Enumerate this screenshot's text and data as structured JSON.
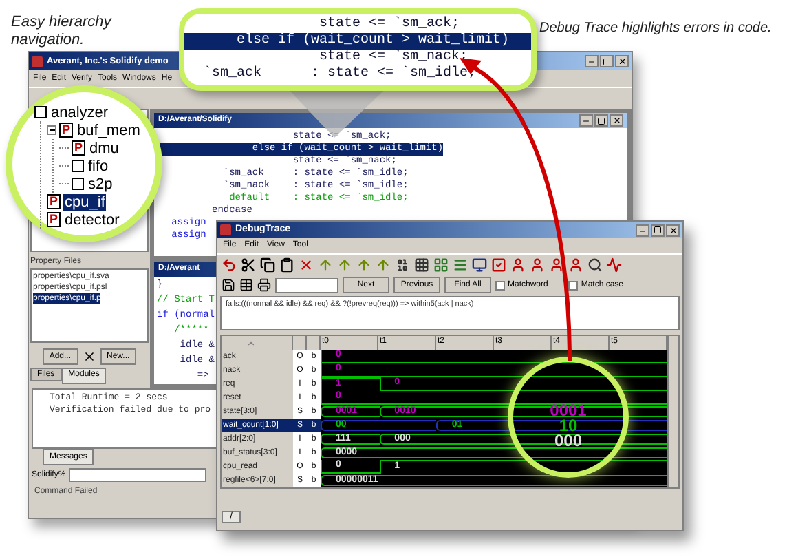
{
  "captions": [
    {
      "text": "Easy hierarchy navigation."
    },
    {
      "text": "Debug Trace highlights errors in code."
    }
  ],
  "main_window": {
    "title": "Averant, Inc.'s Solidify demo",
    "menu": [
      "File",
      "Edit",
      "Verify",
      "Tools",
      "Windows",
      "He"
    ],
    "code_window": {
      "title": "D:/Averant/Solidify",
      "lines": [
        {
          "text": "                        state <= `sm_ack;",
          "kind": "statement",
          "selected": false
        },
        {
          "text": "                 else if (wait_count > wait_limit)",
          "selected": true
        },
        {
          "text": "                        state <= `sm_nack;",
          "kind": "statement",
          "selected": false
        },
        {
          "text": "            `sm_ack     : state <= `sm_idle;",
          "kind": "statement",
          "selected": false
        },
        {
          "text": "            `sm_nack    : state <= `sm_idle;",
          "kind": "statement",
          "selected": false
        },
        {
          "text": "             default    : state <= `sm_idle;",
          "kind": "comment",
          "selected": false
        },
        {
          "text": "          endcase",
          "kind": "statement",
          "selected": false
        },
        {
          "text": "   assign",
          "kind": "keyword",
          "selected": false
        },
        {
          "text": "   assign",
          "kind": "keyword",
          "selected": false
        }
      ]
    },
    "lower_window": {
      "title": "D:/Averant",
      "lines": [
        {
          "text": "}",
          "kind": "statement"
        },
        {
          "text": "// Start T",
          "kind": "comment"
        },
        {
          "text": "if (normal",
          "kind": "keyword"
        },
        {
          "text": "   /*****",
          "kind": "comment"
        },
        {
          "text": "    idle &",
          "kind": "statement"
        },
        {
          "text": "    idle &",
          "kind": "statement"
        },
        {
          "text": "       =>",
          "kind": "statement"
        }
      ]
    },
    "property_files": {
      "label": "Property Files",
      "items": [
        {
          "text": "properties\\cpu_if.sva",
          "selected": false
        },
        {
          "text": "properties\\cpu_if.psl",
          "selected": false
        },
        {
          "text": "properties\\cpu_if.p",
          "selected": true
        }
      ]
    },
    "buttons": [
      "Add...",
      "New..."
    ],
    "tabs": [
      {
        "label": "Files",
        "selected": false
      },
      {
        "label": "Modules",
        "selected": true
      }
    ],
    "messages": {
      "lines": [
        "Total Runtime = 2 secs",
        "Verification failed due to pro"
      ],
      "tab": "Messages"
    },
    "prompt": "Solidify%",
    "status": "Command Failed"
  },
  "tree_callout": {
    "tree": [
      {
        "label": "analyzer",
        "selected": false,
        "children": [
          {
            "label": "buf_mem",
            "badge": "P",
            "selected": false,
            "children": [
              {
                "label": "dmu",
                "badge": "P",
                "selected": false
              },
              {
                "label": "fifo",
                "selected": false
              },
              {
                "label": "s2p",
                "selected": false
              }
            ]
          },
          {
            "label": "cpu_if",
            "badge": "P",
            "selected": true
          },
          {
            "label": "detector",
            "badge": "P",
            "selected": false
          }
        ]
      }
    ]
  },
  "code_callout": {
    "lines": [
      {
        "text": "                state <= `sm_ack;",
        "selected": false
      },
      {
        "text": "      else if (wait_count > wait_limit)",
        "selected": true
      },
      {
        "text": "                state <= `sm_nack;",
        "selected": false
      },
      {
        "text": "  `sm_ack      : state <= `sm_idle;",
        "selected": false
      }
    ]
  },
  "debug_trace": {
    "title": "DebugTrace",
    "menu": [
      "File",
      "Edit",
      "View",
      "Tool"
    ],
    "search_buttons": [
      "Next",
      "Previous",
      "Find All"
    ],
    "checkboxes": [
      {
        "label": "Matchword",
        "checked": false
      },
      {
        "label": "Match case",
        "checked": false
      }
    ],
    "expression": "fails:(((normal && idle) && req) && ?(!prevreq(req))) => within5(ack | nack)",
    "columns": [
      "t0",
      "t1",
      "t2",
      "t3",
      "t4",
      "t5"
    ],
    "signals": [
      {
        "name": "ack",
        "dir": "O",
        "format": "b",
        "kind": "bit",
        "color": "#c000c0",
        "selected": false,
        "wave": [
          {
            "edge": true,
            "value": "0",
            "high": false
          },
          {
            "edge": false
          },
          {
            "edge": false
          },
          {
            "edge": false
          },
          {
            "edge": false
          },
          {
            "edge": false
          }
        ]
      },
      {
        "name": "nack",
        "dir": "O",
        "format": "b",
        "kind": "bit",
        "color": "#c000c0",
        "selected": false,
        "wave": [
          {
            "edge": true,
            "value": "0",
            "high": false
          },
          {
            "edge": false
          },
          {
            "edge": false
          },
          {
            "edge": false
          },
          {
            "edge": false
          },
          {
            "edge": false
          }
        ]
      },
      {
        "name": "req",
        "dir": "I",
        "format": "b",
        "kind": "bit",
        "color": "#c000c0",
        "selected": false,
        "wave": [
          {
            "edge": true,
            "value": "1",
            "high": true
          },
          {
            "edge": true,
            "value": "0",
            "high": false
          },
          {
            "edge": false
          },
          {
            "edge": false
          },
          {
            "edge": false
          },
          {
            "edge": false
          }
        ]
      },
      {
        "name": "reset",
        "dir": "I",
        "format": "b",
        "kind": "bit",
        "color": "#c000c0",
        "selected": false,
        "wave": [
          {
            "edge": true,
            "value": "0",
            "high": false
          },
          {
            "edge": false
          },
          {
            "edge": false
          },
          {
            "edge": false
          },
          {
            "edge": false
          },
          {
            "edge": false
          }
        ]
      },
      {
        "name": "state[3:0]",
        "dir": "S",
        "format": "b",
        "kind": "bus",
        "color": "#c000c0",
        "selected": false,
        "wave": [
          {
            "edge": true,
            "value": "0001"
          },
          {
            "edge": true,
            "value": "0010"
          },
          {
            "edge": false
          },
          {
            "edge": false
          },
          {
            "edge": false
          },
          {
            "edge": false
          }
        ]
      },
      {
        "name": "wait_count[1:0]",
        "dir": "S",
        "format": "b",
        "kind": "bus",
        "color": "#00c000",
        "selected": true,
        "wave": [
          {
            "edge": true,
            "value": "00"
          },
          {
            "edge": false
          },
          {
            "edge": true,
            "value": "01"
          },
          {
            "edge": false
          },
          {
            "edge": false
          },
          {
            "edge": false
          }
        ]
      },
      {
        "name": "addr[2:0]",
        "dir": "I",
        "format": "b",
        "kind": "bus",
        "color": "#e0e0e0",
        "selected": false,
        "wave": [
          {
            "edge": true,
            "value": "111"
          },
          {
            "edge": true,
            "value": "000"
          },
          {
            "edge": false
          },
          {
            "edge": false
          },
          {
            "edge": false
          },
          {
            "edge": false
          }
        ]
      },
      {
        "name": "buf_status[3:0]",
        "dir": "I",
        "format": "b",
        "kind": "bus",
        "color": "#e0e0e0",
        "selected": false,
        "wave": [
          {
            "edge": true,
            "value": "0000"
          },
          {
            "edge": false
          },
          {
            "edge": false
          },
          {
            "edge": false
          },
          {
            "edge": false
          },
          {
            "edge": false
          }
        ]
      },
      {
        "name": "cpu_read",
        "dir": "O",
        "format": "b",
        "kind": "bit",
        "color": "#e0e0e0",
        "selected": false,
        "wave": [
          {
            "edge": true,
            "value": "0",
            "high": false
          },
          {
            "edge": true,
            "value": "1",
            "high": true
          },
          {
            "edge": false
          },
          {
            "edge": false
          },
          {
            "edge": false
          },
          {
            "edge": false
          }
        ]
      },
      {
        "name": "regfile<6>[7:0]",
        "dir": "S",
        "format": "b",
        "kind": "bus",
        "color": "#e0e0e0",
        "selected": false,
        "wave": [
          {
            "edge": true,
            "value": "00000011"
          },
          {
            "edge": false
          },
          {
            "edge": false
          },
          {
            "edge": false
          },
          {
            "edge": false
          },
          {
            "edge": false
          }
        ]
      }
    ],
    "magnifier": [
      {
        "text": "0001",
        "color": "#c000c0"
      },
      {
        "text": "10",
        "color": "#00c000"
      },
      {
        "text": "000",
        "color": "#e0e0e0"
      }
    ],
    "tab": "/"
  }
}
